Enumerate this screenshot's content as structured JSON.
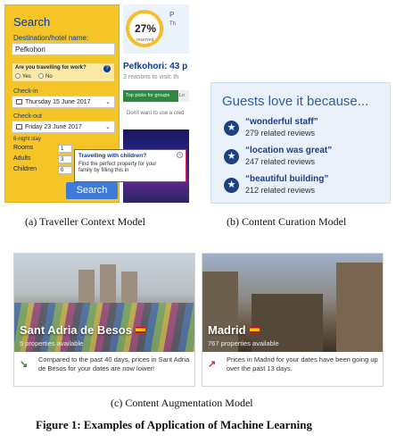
{
  "panel_a": {
    "search_title": "Search",
    "destination_label": "Destination/hotel name:",
    "destination_value": "Pefkohori",
    "work_question": "Are you travelling for work?",
    "work_help": "?",
    "work_yes": "Yes",
    "work_no": "No",
    "checkin_label": "Check-in",
    "checkin_value": "Thursday 15 June 2017",
    "checkout_label": "Check-out",
    "checkout_value": "Friday 23 June 2017",
    "night_stay": "8-night stay",
    "rooms_label": "Rooms",
    "rooms_value": "1",
    "adults_label": "Adults",
    "adults_value": "3",
    "children_label": "Children",
    "children_value": "0",
    "search_button": "Search",
    "tooltip_title": "Travelling with children?",
    "tooltip_body": "Find the perfect property for your family by filling this in",
    "tooltip_close": "×"
  },
  "hotel": {
    "gauge_value": "27%",
    "gauge_label": "reserved",
    "header_p": "P",
    "header_t": "Th",
    "name": "Pefkohori: 43 p",
    "reasons": "3 reasons to visit: th",
    "tab_groups": "Top picks for groups",
    "tab_lo": "Lo",
    "dont_want": "Don't want to use a cred"
  },
  "panel_b": {
    "title": "Guests love it because...",
    "reasons": [
      {
        "quote": "“wonderful staff”",
        "count": "279 related reviews"
      },
      {
        "quote": "“location was great”",
        "count": "247 related reviews"
      },
      {
        "quote": "“beautiful building”",
        "count": "212 related reviews"
      }
    ],
    "star_icon": "★"
  },
  "cards": {
    "barcelona": {
      "city": "Sant Adria de Besos",
      "properties": "5 properties available",
      "trend_text": "Compared to the past 40 days, prices in Sant Adria de Besos for your dates are now lower!",
      "trend_icon": "↘",
      "trend_color": "#2b8a3e"
    },
    "madrid": {
      "city": "Madrid",
      "properties": "767 properties available",
      "trend_text": "Prices in Madrid for your dates have been going up over the past 13 days.",
      "trend_icon": "↗",
      "trend_color": "#d12a3a"
    }
  },
  "captions": {
    "a": "(a)  Traveller Context Model",
    "b": "(b)  Content Curation Model",
    "c": "(c)  Content Augmentation Model"
  },
  "figure_title": "Figure 1: Examples of Application of Machine Learning"
}
